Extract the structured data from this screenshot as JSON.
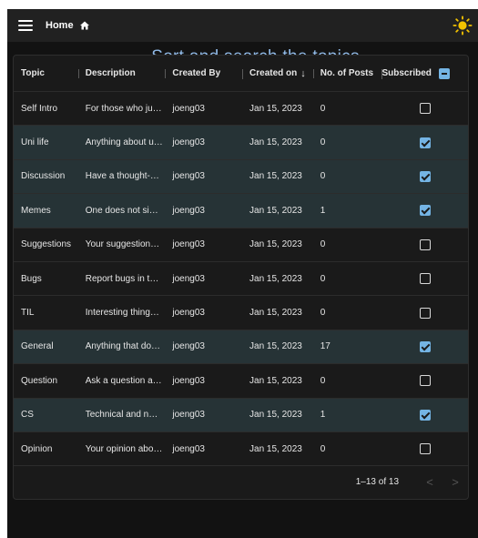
{
  "header": {
    "home_label": "Home"
  },
  "page": {
    "heading": "Sort and search the topics"
  },
  "table": {
    "columns": [
      "Topic",
      "Description",
      "Created By",
      "Created on",
      "No. of Posts",
      "Subscribed"
    ],
    "sort_indicator": "↓",
    "rows": [
      {
        "topic": "Self Intro",
        "description": "For those who ju…",
        "created_by": "joeng03",
        "created_on": "Jan 15, 2023",
        "posts": "0",
        "subscribed": false
      },
      {
        "topic": "Uni life",
        "description": "Anything about u…",
        "created_by": "joeng03",
        "created_on": "Jan 15, 2023",
        "posts": "0",
        "subscribed": true
      },
      {
        "topic": "Discussion",
        "description": "Have a thought-…",
        "created_by": "joeng03",
        "created_on": "Jan 15, 2023",
        "posts": "0",
        "subscribed": true
      },
      {
        "topic": "Memes",
        "description": "One does not si…",
        "created_by": "joeng03",
        "created_on": "Jan 15, 2023",
        "posts": "1",
        "subscribed": true
      },
      {
        "topic": "Suggestions",
        "description": "Your suggestion…",
        "created_by": "joeng03",
        "created_on": "Jan 15, 2023",
        "posts": "0",
        "subscribed": false
      },
      {
        "topic": "Bugs",
        "description": "Report bugs in t…",
        "created_by": "joeng03",
        "created_on": "Jan 15, 2023",
        "posts": "0",
        "subscribed": false
      },
      {
        "topic": "TIL",
        "description": "Interesting thing…",
        "created_by": "joeng03",
        "created_on": "Jan 15, 2023",
        "posts": "0",
        "subscribed": false
      },
      {
        "topic": "General",
        "description": "Anything that do…",
        "created_by": "joeng03",
        "created_on": "Jan 15, 2023",
        "posts": "17",
        "subscribed": true
      },
      {
        "topic": "Question",
        "description": "Ask a question a…",
        "created_by": "joeng03",
        "created_on": "Jan 15, 2023",
        "posts": "0",
        "subscribed": false
      },
      {
        "topic": "CS",
        "description": "Technical and n…",
        "created_by": "joeng03",
        "created_on": "Jan 15, 2023",
        "posts": "1",
        "subscribed": true
      },
      {
        "topic": "Opinion",
        "description": "Your opinion abo…",
        "created_by": "joeng03",
        "created_on": "Jan 15, 2023",
        "posts": "0",
        "subscribed": false
      }
    ]
  },
  "pagination": {
    "label": "1–13 of 13",
    "prev_icon": "chevron-left-icon",
    "next_icon": "chevron-right-icon"
  },
  "colors": {
    "accent": "#74b4e4",
    "heading": "#90b9e6",
    "subscribed_row": "#263336",
    "background": "#121212"
  }
}
